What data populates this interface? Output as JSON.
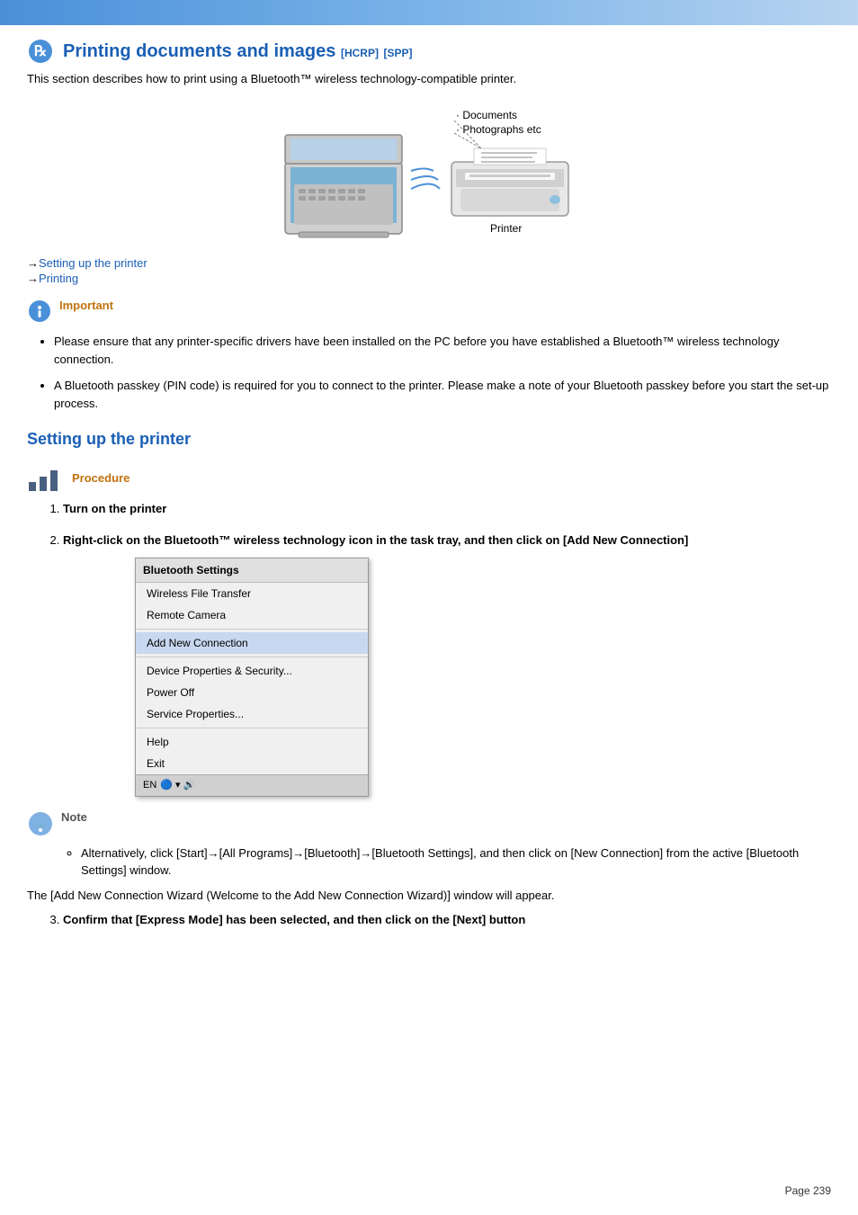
{
  "topbar": {
    "visible": true
  },
  "header": {
    "title": "Printing documents and images",
    "badge1": "[HCRP]",
    "badge2": "[SPP]",
    "description": "This section describes how to print using a Bluetooth™ wireless technology-compatible printer."
  },
  "diagram": {
    "labels": {
      "documents": "· Documents",
      "photographs": "· Photographs etc",
      "printer": "Printer"
    }
  },
  "nav": {
    "link1_arrow": "→",
    "link1_text": "Setting up the printer",
    "link2_arrow": "→",
    "link2_text": "Printing"
  },
  "important": {
    "label": "Important",
    "bullets": [
      "Please ensure that any printer-specific drivers have been installed on the PC before you have established a Bluetooth™ wireless technology connection.",
      "A Bluetooth passkey (PIN code) is required for you to connect to the printer. Please make a note of your Bluetooth passkey before you start the set-up process."
    ]
  },
  "section_heading": "Setting up the printer",
  "procedure": {
    "label": "Procedure",
    "steps": [
      {
        "number": "1.",
        "text": "Turn on the printer"
      },
      {
        "number": "2.",
        "text": "Right-click on the Bluetooth™ wireless technology icon in the task tray, and then click on [Add New Connection]"
      },
      {
        "number": "3.",
        "text": "Confirm that [Express Mode] has been selected, and then click on the [Next] button"
      }
    ]
  },
  "context_menu": {
    "header": "Bluetooth Settings",
    "items": [
      {
        "text": "Wireless File Transfer",
        "type": "normal"
      },
      {
        "text": "Remote Camera",
        "type": "normal"
      },
      {
        "text": "separator"
      },
      {
        "text": "Add New Connection",
        "type": "highlighted"
      },
      {
        "text": "separator"
      },
      {
        "text": "Device Properties & Security...",
        "type": "normal"
      },
      {
        "text": "Power Off",
        "type": "normal"
      },
      {
        "text": "Service Properties...",
        "type": "normal"
      },
      {
        "text": "separator"
      },
      {
        "text": "Help",
        "type": "normal"
      },
      {
        "text": "Exit",
        "type": "normal"
      }
    ],
    "taskbar_text": "EN"
  },
  "note": {
    "label": "Note",
    "bullets": [
      "Alternatively, click [Start]→[All Programs]→[Bluetooth]→[Bluetooth Settings], and then click on [New Connection] from the active [Bluetooth Settings] window."
    ]
  },
  "wizard_text": "The [Add New Connection Wizard (Welcome to the Add New Connection Wizard)] window will appear.",
  "page_number": "Page 239"
}
